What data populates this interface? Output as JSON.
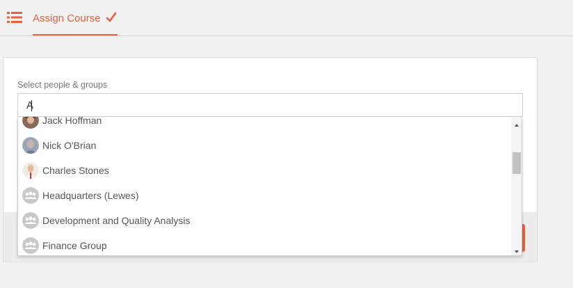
{
  "header": {
    "tab_label": "Assign Course",
    "menu_icon": "list-icon",
    "tab_icon": "checkmark-icon"
  },
  "form": {
    "label": "Select people & groups",
    "search_value": "A"
  },
  "dropdown": {
    "options": [
      {
        "label": "Jack Hoffman",
        "type": "person",
        "icon": "user-avatar"
      },
      {
        "label": "Nick O'Brian",
        "type": "person",
        "icon": "user-avatar"
      },
      {
        "label": "Charles Stones",
        "type": "person",
        "icon": "user-avatar"
      },
      {
        "label": "Headquarters (Lewes)",
        "type": "group",
        "icon": "group-icon"
      },
      {
        "label": "Development and Quality Analysis",
        "type": "group",
        "icon": "group-icon"
      },
      {
        "label": "Finance Group",
        "type": "group",
        "icon": "group-icon"
      }
    ]
  },
  "colors": {
    "accent": "#e8603c",
    "background": "#f1f1f1",
    "card": "#ffffff",
    "footer": "#ececec",
    "text": "#555555"
  }
}
